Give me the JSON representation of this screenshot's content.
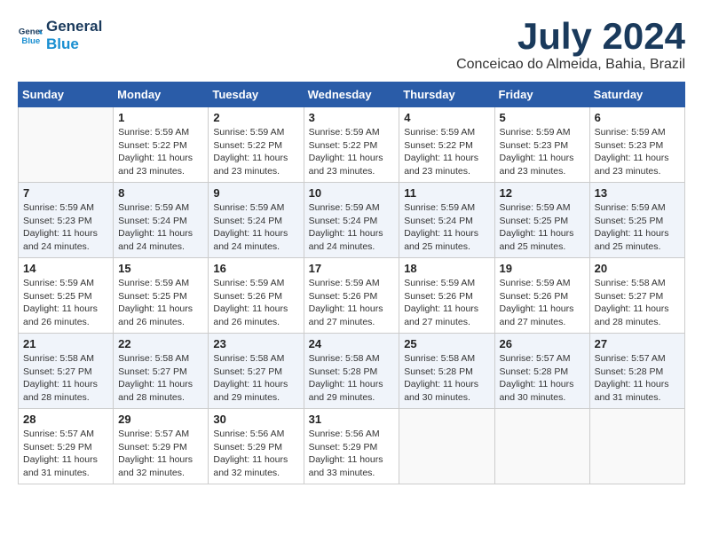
{
  "header": {
    "logo_line1": "General",
    "logo_line2": "Blue",
    "month_year": "July 2024",
    "location": "Conceicao do Almeida, Bahia, Brazil"
  },
  "days_of_week": [
    "Sunday",
    "Monday",
    "Tuesday",
    "Wednesday",
    "Thursday",
    "Friday",
    "Saturday"
  ],
  "weeks": [
    [
      {
        "day": "",
        "sunrise": "",
        "sunset": "",
        "daylight": ""
      },
      {
        "day": "1",
        "sunrise": "Sunrise: 5:59 AM",
        "sunset": "Sunset: 5:22 PM",
        "daylight": "Daylight: 11 hours and 23 minutes."
      },
      {
        "day": "2",
        "sunrise": "Sunrise: 5:59 AM",
        "sunset": "Sunset: 5:22 PM",
        "daylight": "Daylight: 11 hours and 23 minutes."
      },
      {
        "day": "3",
        "sunrise": "Sunrise: 5:59 AM",
        "sunset": "Sunset: 5:22 PM",
        "daylight": "Daylight: 11 hours and 23 minutes."
      },
      {
        "day": "4",
        "sunrise": "Sunrise: 5:59 AM",
        "sunset": "Sunset: 5:22 PM",
        "daylight": "Daylight: 11 hours and 23 minutes."
      },
      {
        "day": "5",
        "sunrise": "Sunrise: 5:59 AM",
        "sunset": "Sunset: 5:23 PM",
        "daylight": "Daylight: 11 hours and 23 minutes."
      },
      {
        "day": "6",
        "sunrise": "Sunrise: 5:59 AM",
        "sunset": "Sunset: 5:23 PM",
        "daylight": "Daylight: 11 hours and 23 minutes."
      }
    ],
    [
      {
        "day": "7",
        "sunrise": "Sunrise: 5:59 AM",
        "sunset": "Sunset: 5:23 PM",
        "daylight": "Daylight: 11 hours and 24 minutes."
      },
      {
        "day": "8",
        "sunrise": "Sunrise: 5:59 AM",
        "sunset": "Sunset: 5:24 PM",
        "daylight": "Daylight: 11 hours and 24 minutes."
      },
      {
        "day": "9",
        "sunrise": "Sunrise: 5:59 AM",
        "sunset": "Sunset: 5:24 PM",
        "daylight": "Daylight: 11 hours and 24 minutes."
      },
      {
        "day": "10",
        "sunrise": "Sunrise: 5:59 AM",
        "sunset": "Sunset: 5:24 PM",
        "daylight": "Daylight: 11 hours and 24 minutes."
      },
      {
        "day": "11",
        "sunrise": "Sunrise: 5:59 AM",
        "sunset": "Sunset: 5:24 PM",
        "daylight": "Daylight: 11 hours and 25 minutes."
      },
      {
        "day": "12",
        "sunrise": "Sunrise: 5:59 AM",
        "sunset": "Sunset: 5:25 PM",
        "daylight": "Daylight: 11 hours and 25 minutes."
      },
      {
        "day": "13",
        "sunrise": "Sunrise: 5:59 AM",
        "sunset": "Sunset: 5:25 PM",
        "daylight": "Daylight: 11 hours and 25 minutes."
      }
    ],
    [
      {
        "day": "14",
        "sunrise": "Sunrise: 5:59 AM",
        "sunset": "Sunset: 5:25 PM",
        "daylight": "Daylight: 11 hours and 26 minutes."
      },
      {
        "day": "15",
        "sunrise": "Sunrise: 5:59 AM",
        "sunset": "Sunset: 5:25 PM",
        "daylight": "Daylight: 11 hours and 26 minutes."
      },
      {
        "day": "16",
        "sunrise": "Sunrise: 5:59 AM",
        "sunset": "Sunset: 5:26 PM",
        "daylight": "Daylight: 11 hours and 26 minutes."
      },
      {
        "day": "17",
        "sunrise": "Sunrise: 5:59 AM",
        "sunset": "Sunset: 5:26 PM",
        "daylight": "Daylight: 11 hours and 27 minutes."
      },
      {
        "day": "18",
        "sunrise": "Sunrise: 5:59 AM",
        "sunset": "Sunset: 5:26 PM",
        "daylight": "Daylight: 11 hours and 27 minutes."
      },
      {
        "day": "19",
        "sunrise": "Sunrise: 5:59 AM",
        "sunset": "Sunset: 5:26 PM",
        "daylight": "Daylight: 11 hours and 27 minutes."
      },
      {
        "day": "20",
        "sunrise": "Sunrise: 5:58 AM",
        "sunset": "Sunset: 5:27 PM",
        "daylight": "Daylight: 11 hours and 28 minutes."
      }
    ],
    [
      {
        "day": "21",
        "sunrise": "Sunrise: 5:58 AM",
        "sunset": "Sunset: 5:27 PM",
        "daylight": "Daylight: 11 hours and 28 minutes."
      },
      {
        "day": "22",
        "sunrise": "Sunrise: 5:58 AM",
        "sunset": "Sunset: 5:27 PM",
        "daylight": "Daylight: 11 hours and 28 minutes."
      },
      {
        "day": "23",
        "sunrise": "Sunrise: 5:58 AM",
        "sunset": "Sunset: 5:27 PM",
        "daylight": "Daylight: 11 hours and 29 minutes."
      },
      {
        "day": "24",
        "sunrise": "Sunrise: 5:58 AM",
        "sunset": "Sunset: 5:28 PM",
        "daylight": "Daylight: 11 hours and 29 minutes."
      },
      {
        "day": "25",
        "sunrise": "Sunrise: 5:58 AM",
        "sunset": "Sunset: 5:28 PM",
        "daylight": "Daylight: 11 hours and 30 minutes."
      },
      {
        "day": "26",
        "sunrise": "Sunrise: 5:57 AM",
        "sunset": "Sunset: 5:28 PM",
        "daylight": "Daylight: 11 hours and 30 minutes."
      },
      {
        "day": "27",
        "sunrise": "Sunrise: 5:57 AM",
        "sunset": "Sunset: 5:28 PM",
        "daylight": "Daylight: 11 hours and 31 minutes."
      }
    ],
    [
      {
        "day": "28",
        "sunrise": "Sunrise: 5:57 AM",
        "sunset": "Sunset: 5:29 PM",
        "daylight": "Daylight: 11 hours and 31 minutes."
      },
      {
        "day": "29",
        "sunrise": "Sunrise: 5:57 AM",
        "sunset": "Sunset: 5:29 PM",
        "daylight": "Daylight: 11 hours and 32 minutes."
      },
      {
        "day": "30",
        "sunrise": "Sunrise: 5:56 AM",
        "sunset": "Sunset: 5:29 PM",
        "daylight": "Daylight: 11 hours and 32 minutes."
      },
      {
        "day": "31",
        "sunrise": "Sunrise: 5:56 AM",
        "sunset": "Sunset: 5:29 PM",
        "daylight": "Daylight: 11 hours and 33 minutes."
      },
      {
        "day": "",
        "sunrise": "",
        "sunset": "",
        "daylight": ""
      },
      {
        "day": "",
        "sunrise": "",
        "sunset": "",
        "daylight": ""
      },
      {
        "day": "",
        "sunrise": "",
        "sunset": "",
        "daylight": ""
      }
    ]
  ]
}
